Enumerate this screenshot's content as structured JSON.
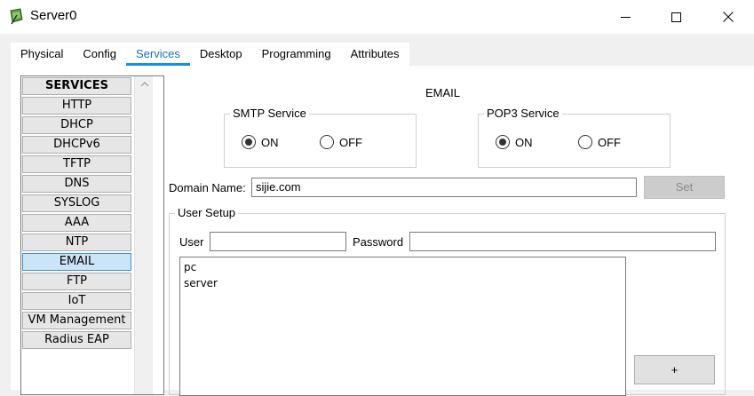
{
  "window": {
    "title": "Server0",
    "controls": {
      "minimize": "minimize",
      "maximize": "maximize",
      "close": "close"
    }
  },
  "tabs": [
    {
      "label": "Physical",
      "active": false
    },
    {
      "label": "Config",
      "active": false
    },
    {
      "label": "Services",
      "active": true
    },
    {
      "label": "Desktop",
      "active": false
    },
    {
      "label": "Programming",
      "active": false
    },
    {
      "label": "Attributes",
      "active": false
    }
  ],
  "services": {
    "header": "SERVICES",
    "items": [
      "HTTP",
      "DHCP",
      "DHCPv6",
      "TFTP",
      "DNS",
      "SYSLOG",
      "AAA",
      "NTP",
      "EMAIL",
      "FTP",
      "IoT",
      "VM Management",
      "Radius EAP"
    ],
    "selected": "EMAIL"
  },
  "email": {
    "title": "EMAIL",
    "smtp": {
      "legend": "SMTP Service",
      "on_label": "ON",
      "off_label": "OFF",
      "value": "ON"
    },
    "pop3": {
      "legend": "POP3 Service",
      "on_label": "ON",
      "off_label": "OFF",
      "value": "ON"
    },
    "domain": {
      "label": "Domain Name:",
      "value": "sijie.com",
      "set_label": "Set"
    },
    "user_setup": {
      "legend": "User Setup",
      "user_label": "User",
      "user_value": "",
      "password_label": "Password",
      "password_value": "",
      "users": [
        "pc",
        "server"
      ],
      "add_label": "+"
    }
  },
  "colors": {
    "accent": "#1a8fd6",
    "selected_bg": "#cce4f7",
    "window_bg": "#f0f0f0"
  }
}
